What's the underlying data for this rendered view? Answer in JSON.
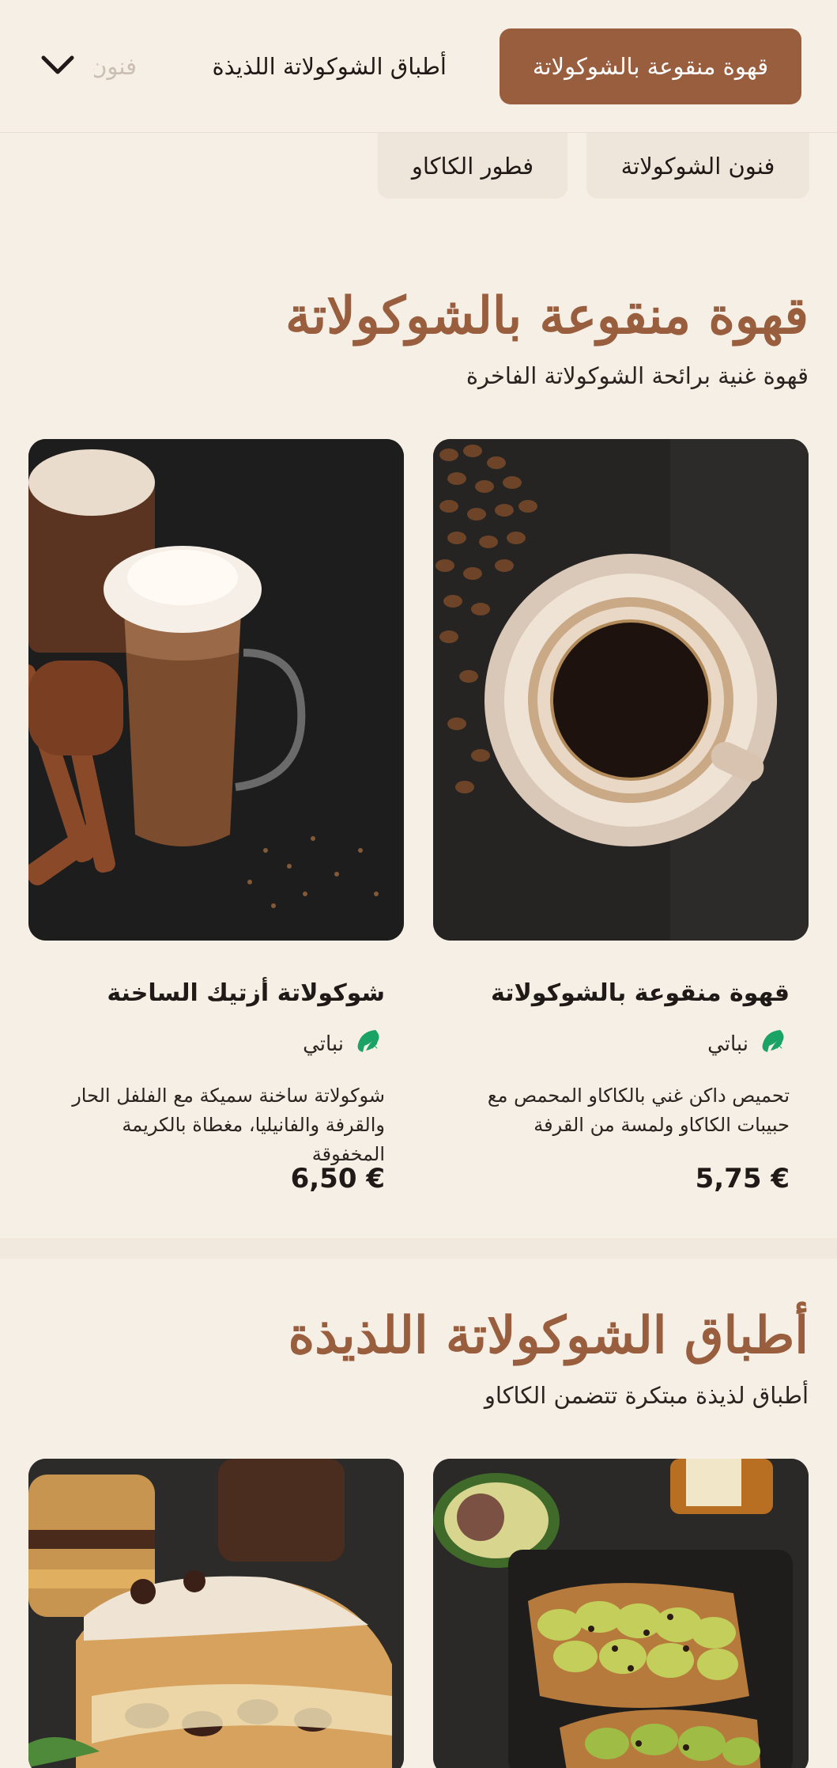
{
  "nav": {
    "active_tab": "قهوة منقوعة بالشوكولاتة",
    "tab_2": "أطباق الشوكولاتة اللذيذة",
    "tab_3_partial": "فنون",
    "row2": [
      "فنون الشوكولاتة",
      "فطور الكاكاو"
    ]
  },
  "sections": [
    {
      "title": "قهوة منقوعة بالشوكولاتة",
      "subtitle": "قهوة غنية برائحة الشوكولاتة الفاخرة",
      "items": [
        {
          "name": "قهوة منقوعة بالشوكولاتة",
          "tag": "نباتي",
          "description": "تحميص داكن غني بالكاكاو المحمص مع حبيبات الكاكاو ولمسة من القرفة",
          "price": "5,75 €",
          "image": "cup-of-black-coffee-with-beans"
        },
        {
          "name": "شوكولاتة أزتيك الساخنة",
          "tag": "نباتي",
          "description": "شوكولاتة ساخنة سميكة مع الفلفل الحار والقرفة والفانيليا، مغطاة بالكريمة المخفوقة",
          "price": "6,50 €",
          "image": "hot-chocolate-with-cream-and-cinnamon"
        }
      ]
    },
    {
      "title": "أطباق الشوكولاتة اللذيذة",
      "subtitle": "أطباق لذيذة مبتكرة تتضمن الكاكاو",
      "items": [
        {
          "image": "avocado-toast-with-cacao-nibs"
        },
        {
          "image": "chocolate-stuffed-french-toast"
        }
      ]
    }
  ],
  "colors": {
    "background": "#f6efe6",
    "accent": "#985e3e",
    "vegan_icon": "#1aa365",
    "text": "#1f1a17"
  },
  "icons": {
    "dropdown": "chevron-down-icon",
    "vegan": "vegan-leaf-icon"
  }
}
